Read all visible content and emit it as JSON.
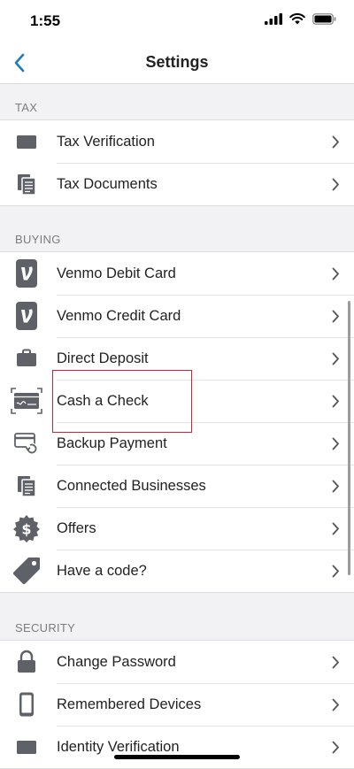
{
  "status": {
    "time": "1:55"
  },
  "nav": {
    "title": "Settings"
  },
  "sections": [
    {
      "header": "TAX",
      "items": [
        {
          "label": "Tax Verification",
          "icon": "card-icon"
        },
        {
          "label": "Tax Documents",
          "icon": "documents-icon"
        }
      ]
    },
    {
      "header": "BUYING",
      "items": [
        {
          "label": "Venmo Debit Card",
          "icon": "venmo-icon"
        },
        {
          "label": "Venmo Credit Card",
          "icon": "venmo-icon"
        },
        {
          "label": "Direct Deposit",
          "icon": "briefcase-icon"
        },
        {
          "label": "Cash a Check",
          "icon": "check-scan-icon"
        },
        {
          "label": "Backup Payment",
          "icon": "backup-card-icon"
        },
        {
          "label": "Connected Businesses",
          "icon": "documents-icon"
        },
        {
          "label": "Offers",
          "icon": "dollar-badge-icon"
        },
        {
          "label": "Have a code?",
          "icon": "tag-icon"
        }
      ]
    },
    {
      "header": "SECURITY",
      "items": [
        {
          "label": "Change Password",
          "icon": "lock-icon"
        },
        {
          "label": "Remembered Devices",
          "icon": "phone-icon"
        },
        {
          "label": "Identity Verification",
          "icon": "card-icon"
        }
      ]
    }
  ],
  "colors": {
    "accent": "#1f7bc1",
    "icon": "#5f6169",
    "highlight": "#c9272e"
  }
}
